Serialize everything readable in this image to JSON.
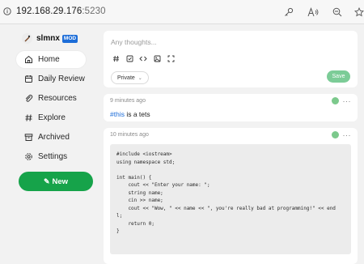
{
  "browser": {
    "url_host": "192.168.29.176",
    "url_port": ":5230"
  },
  "sidebar": {
    "user_name": "slmnx",
    "user_badge": "MOD",
    "items": [
      {
        "label": "Home",
        "icon": "home-icon",
        "active": true
      },
      {
        "label": "Daily Review",
        "icon": "calendar-icon",
        "active": false
      },
      {
        "label": "Resources",
        "icon": "paperclip-icon",
        "active": false
      },
      {
        "label": "Explore",
        "icon": "hash-icon",
        "active": false
      },
      {
        "label": "Archived",
        "icon": "archive-icon",
        "active": false
      },
      {
        "label": "Settings",
        "icon": "gear-icon",
        "active": false
      }
    ],
    "new_button": "New"
  },
  "composer": {
    "placeholder": "Any thoughts...",
    "visibility": "Private",
    "save_label": "Save"
  },
  "memos": [
    {
      "time": "9 minutes ago",
      "tag": "#this",
      "text": " is a tets"
    },
    {
      "time": "10 minutes ago",
      "code": [
        "#include <iostream>",
        "using namespace std;",
        "",
        "int main() {",
        "    cout << \"Enter your name: \";",
        "    string name;",
        "    cin >> name;",
        "    cout << \"Wow, \" << name << \", you're really bad at programming!\" << end",
        "l;",
        "    return 0;",
        "}"
      ]
    }
  ],
  "colors": {
    "accent_green": "#16a34a",
    "save_green": "#7ccc97",
    "tag_blue": "#1d6dd8",
    "badge_blue": "#1d6dd8"
  }
}
